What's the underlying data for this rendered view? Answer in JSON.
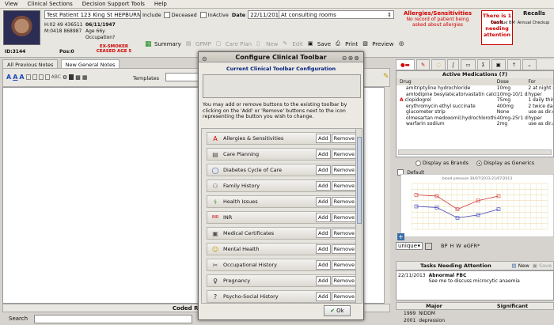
{
  "menu": [
    "View",
    "Clinical Sections",
    "Decision Support Tools",
    "Help"
  ],
  "patient": {
    "name": "Test Patient 123 King St HEPBURN",
    "home_phone": "H:02 49 436511",
    "mobile_phone": "M:0418 868987",
    "dob": "06/11/1947",
    "age": "Age 66y",
    "occupation": "Occupation?",
    "id": "ID:3144",
    "pos": "Pos:0",
    "smoker": "EX-SMOKER CEASED AGE 5"
  },
  "visit": {
    "include_label": "Include",
    "deceased_label": "Deceased",
    "inactive_label": "InActive",
    "date_label": "Date",
    "date_value": "22/11/2013",
    "location": "At consulting rooms"
  },
  "alerts": {
    "allergies_title": "Allergies/Sensitivities",
    "allergies_text": "No record of patient being asked about allergies",
    "task_text": "There is 1 task needing attention",
    "recalls_title": "Recalls",
    "recalls_items": [
      "Overdue BM",
      "Annual Checkup"
    ]
  },
  "toolbar": {
    "summary": "Summary",
    "gmp": "GPMP",
    "care_plan": "Care Plan",
    "new": "New",
    "edit": "Edit",
    "save": "Save",
    "print": "Print",
    "preview": "Preview"
  },
  "left_tabs": [
    "All Previous Notes",
    "New General Notes"
  ],
  "templates_label": "Templates",
  "coded_reasons": "Coded Reasons",
  "search_label": "Search",
  "dialog": {
    "title": "Configure Clinical Toolbar",
    "subtitle": "Current Clinical Toolbar Configuration",
    "instructions": "You may add or remove buttons to the existing toolbar by clicking on the 'Add' or 'Remove' buttons next to the icon representing the button you wish to change.",
    "add_label": "Add",
    "remove_label": "Remove",
    "ok_label": "Ok",
    "items": [
      "Allergies & Sensitivities",
      "Care Planning",
      "Diabetes Cycle of Care",
      "Family History",
      "Health Issues",
      "INR",
      "Medical Certificates",
      "Mental Health",
      "Occupational History",
      "Pregnancy",
      "Psycho-Social History"
    ]
  },
  "meds": {
    "title": "Active Medications (7)",
    "headers": [
      "Drug",
      "Dose",
      "For"
    ],
    "rows": [
      [
        "amitriptyline hydrochloride",
        "10mg",
        "2 at night chronic"
      ],
      [
        "amlodipine besylate;atorvastatin calcium",
        "10mg-10/1 daily",
        "hyper"
      ],
      [
        "clopidogrel",
        "75mg",
        "1 daily  thin th"
      ],
      [
        "erythromycin ethyl succinate",
        "400mg",
        "2 twice darchest"
      ],
      [
        "glucometer strip",
        "None",
        "use as dir.diabet"
      ],
      [
        "olmesartan medoxomil;hydrochlorothiazide",
        "40mg-25r1 daily",
        "hyper"
      ],
      [
        "warfarin sodium",
        "2mg",
        "use as dir.atrial"
      ]
    ],
    "display_brands": "Display as Brands",
    "display_generics": "Display as Generics"
  },
  "obs": {
    "default_label": "Default",
    "chart_title": "blood pressure 30/07/2013-21/07/2013",
    "unique_label": "unique",
    "readouts": [
      "BP",
      "H",
      "W",
      "eGFR*"
    ]
  },
  "chart_data": {
    "type": "line",
    "title": "blood pressure 30/07/2013-21/07/2013",
    "series": [
      {
        "values": [
          120,
          118,
          95,
          110,
          118
        ]
      },
      {
        "values": [
          100,
          98,
          80,
          85,
          95
        ]
      }
    ],
    "ylim": [
      60,
      140
    ],
    "grid": true
  },
  "tasks": {
    "title": "Tasks Needing Attention",
    "new": "New",
    "save": "Save",
    "date": "22/11/2013",
    "heading": "Abnormal FBC",
    "detail": "See me to discuss microcytic anaemia"
  },
  "history": {
    "major": "Major",
    "significant": "Significant",
    "rows": [
      [
        "1999",
        "NIDDM"
      ],
      [
        "2001",
        "depression"
      ]
    ]
  },
  "colors": {
    "alert_red": "#d00000",
    "dialog_title": "#002080",
    "task_border": "#cc0000"
  },
  "icons": [
    "allergy-icon",
    "care-plan-icon",
    "diabetes-icon",
    "family-icon",
    "health-issues-icon",
    "inr-icon",
    "certificate-icon",
    "mental-health-icon",
    "occupational-icon",
    "pregnancy-icon",
    "psycho-social-icon"
  ]
}
